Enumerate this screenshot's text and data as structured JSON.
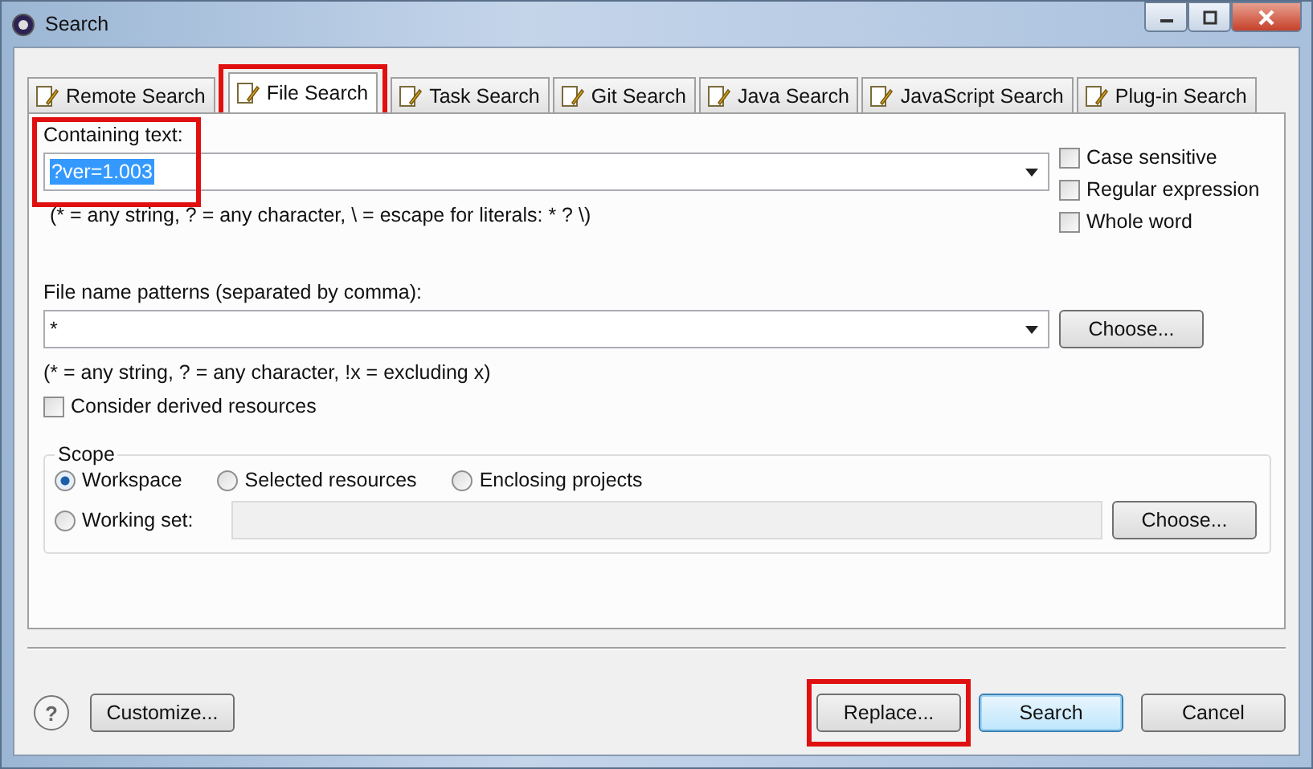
{
  "window": {
    "title": "Search"
  },
  "tabs": [
    {
      "label": "Remote Search",
      "selected": false,
      "highlighted": false
    },
    {
      "label": "File Search",
      "selected": true,
      "highlighted": true
    },
    {
      "label": "Task Search",
      "selected": false,
      "highlighted": false
    },
    {
      "label": "Git Search",
      "selected": false,
      "highlighted": false
    },
    {
      "label": "Java Search",
      "selected": false,
      "highlighted": false
    },
    {
      "label": "JavaScript Search",
      "selected": false,
      "highlighted": false
    },
    {
      "label": "Plug-in Search",
      "selected": false,
      "highlighted": false
    }
  ],
  "containing_text": {
    "label": "Containing text:",
    "value": "?ver=1.003",
    "highlighted": true,
    "hint": "(* = any string, ? = any character, \\ = escape for literals: * ? \\)"
  },
  "options": [
    {
      "label": "Case sensitive",
      "checked": false
    },
    {
      "label": "Regular expression",
      "checked": false
    },
    {
      "label": "Whole word",
      "checked": false
    }
  ],
  "file_name_patterns": {
    "label": "File name patterns (separated by comma):",
    "value": "*",
    "choose_button": "Choose...",
    "hint": "(* = any string, ? = any character, !x = excluding x)"
  },
  "consider_derived": {
    "label": "Consider derived resources",
    "checked": false
  },
  "scope": {
    "title": "Scope",
    "options": [
      {
        "label": "Workspace",
        "selected": true
      },
      {
        "label": "Selected resources",
        "selected": false
      },
      {
        "label": "Enclosing projects",
        "selected": false
      },
      {
        "label": "Working set:",
        "selected": false
      }
    ],
    "choose_button": "Choose..."
  },
  "help_button": "?",
  "customize_button": "Customize...",
  "buttons": [
    {
      "label": "Replace...",
      "default": false,
      "highlighted": true
    },
    {
      "label": "Search",
      "default": true,
      "highlighted": false
    },
    {
      "label": "Cancel",
      "default": false,
      "highlighted": false
    }
  ]
}
